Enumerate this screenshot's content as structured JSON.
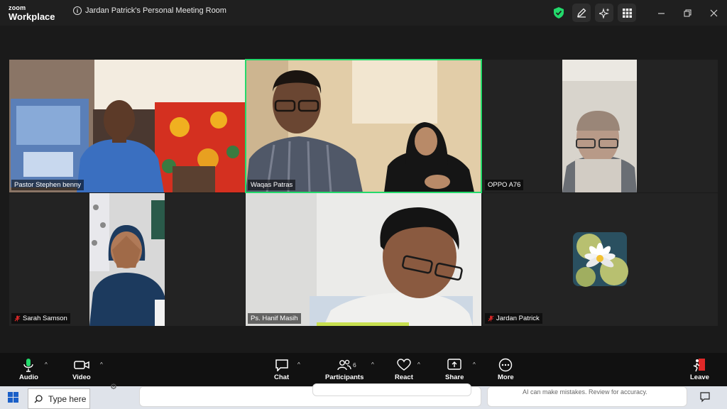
{
  "app": {
    "brand_top": "zoom",
    "brand_bottom": "Workplace",
    "meeting_title": "Jardan Patrick's Personal Meeting Room"
  },
  "titlebar_icons": [
    "shield-check-icon",
    "pen-icon",
    "sparkle-icon",
    "apps-grid-icon"
  ],
  "colors": {
    "active_speaker": "#23d96b",
    "shield": "#23d96b",
    "leave": "#e02828",
    "mute": "#e02828"
  },
  "participants": [
    {
      "name": "Pastor Stephen benny",
      "muted": false,
      "active": false
    },
    {
      "name": "Waqas Patras",
      "muted": false,
      "active": true
    },
    {
      "name": "OPPO A76",
      "muted": false,
      "active": false
    },
    {
      "name": "Sarah Samson",
      "muted": true,
      "active": false
    },
    {
      "name": "Ps. Hanif Masih",
      "muted": false,
      "active": false
    },
    {
      "name": "Jardan Patrick",
      "muted": true,
      "active": false
    }
  ],
  "toolbar": {
    "audio": "Audio",
    "video": "Video",
    "chat": "Chat",
    "participants": "Participants",
    "participants_count": "6",
    "react": "React",
    "share": "Share",
    "more": "More",
    "leave": "Leave"
  },
  "taskbar": {
    "search_text": "Type here",
    "ai_note": "AI can make mistakes. Review for accuracy."
  }
}
